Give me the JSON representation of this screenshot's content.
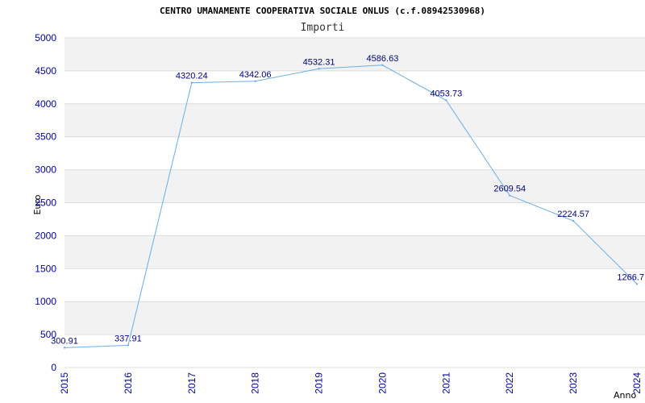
{
  "chart_data": {
    "type": "line",
    "title": "CENTRO UMANAMENTE COOPERATIVA SOCIALE ONLUS (c.f.08942530968)",
    "subtitle": "Importi",
    "xlabel": "Anno",
    "ylabel": "Euro",
    "x": [
      "2015",
      "2016",
      "2017",
      "2018",
      "2019",
      "2020",
      "2021",
      "2022",
      "2023",
      "2024"
    ],
    "values": [
      300.91,
      337.91,
      4320.24,
      4342.06,
      4532.31,
      4586.63,
      4053.73,
      2609.54,
      2224.57,
      1266.7
    ],
    "value_labels": [
      "300.91",
      "337.91",
      "4320.24",
      "4342.06",
      "4532.31",
      "4586.63",
      "4053.73",
      "2609.54",
      "2224.57",
      "1266.7"
    ],
    "yticks": [
      "0",
      "500",
      "1000",
      "1500",
      "2000",
      "2500",
      "3000",
      "3500",
      "4000",
      "4500",
      "5000"
    ],
    "ylim": [
      0,
      5000
    ],
    "grid": "horizontal alternating bands",
    "colors": {
      "line": "#6aaee8",
      "band": "#f2f2f2",
      "gridline": "#dddddd",
      "tick": "#0000aa",
      "label": "#000080"
    }
  }
}
